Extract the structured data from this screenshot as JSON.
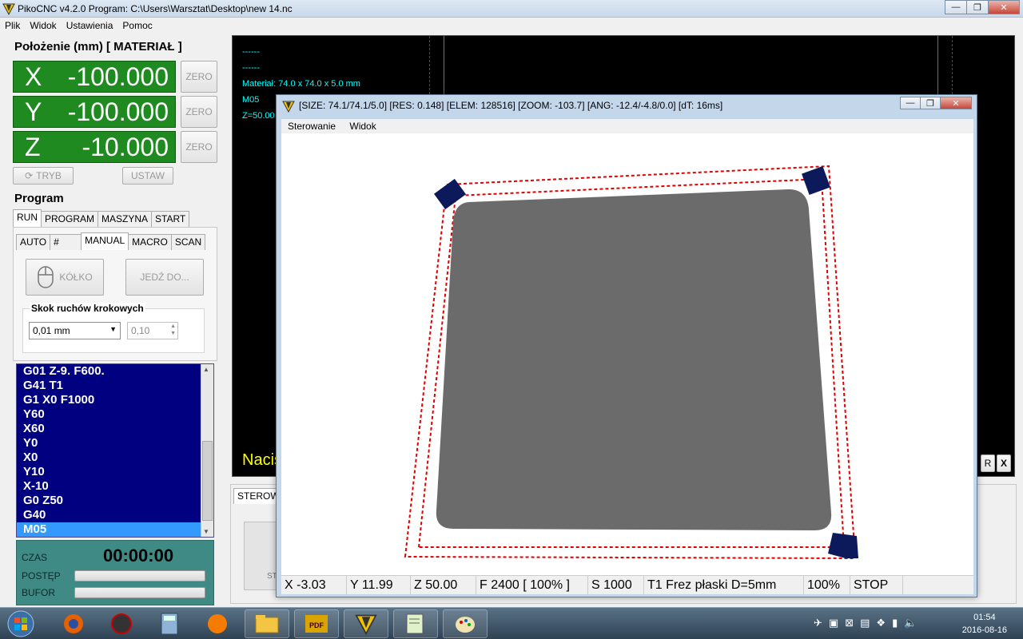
{
  "window": {
    "title": "PikoCNC v4.2.0    Program: C:\\Users\\Warsztat\\Desktop\\new 14.nc",
    "minimize": "—",
    "maximize": "❐",
    "close": "✕"
  },
  "menu": [
    "Plik",
    "Widok",
    "Ustawienia",
    "Pomoc"
  ],
  "position": {
    "title": "Położenie (mm) [ MATERIAŁ ]",
    "axes": [
      {
        "label": "X",
        "value": "-100.000",
        "zero": "ZERO"
      },
      {
        "label": "Y",
        "value": "-100.000",
        "zero": "ZERO"
      },
      {
        "label": "Z",
        "value": "-10.000",
        "zero": "ZERO"
      }
    ],
    "mode_button": "TRYB",
    "set_button": "USTAW"
  },
  "program": {
    "title": "Program",
    "tabs": [
      "RUN",
      "PROGRAM",
      "MASZYNA",
      "START"
    ],
    "subtabs": [
      "AUTO",
      "#",
      "MANUAL",
      "MACRO",
      "SCAN"
    ],
    "wheel_button": "KÓŁKO",
    "goto_button": "JEDŹ DO...",
    "step_group": "Skok ruchów krokowych",
    "step_select": "0,01 mm",
    "step_spin": "0,10",
    "gcode": [
      "G01 Z-9. F600.",
      "G41 T1",
      "G1 X0 F1000",
      "Y60",
      "X60",
      "Y0",
      "X0",
      "Y10",
      "X-10",
      "G0 Z50",
      "G40",
      "M05"
    ],
    "selected_line": 11
  },
  "status": {
    "time_label": "CZAS",
    "time_value": "00:00:00",
    "progress_label": "POSTĘP",
    "buffer_label": "BUFOR",
    "progress": 0,
    "buffer": 0
  },
  "view": {
    "lines": [
      "------",
      "------",
      "Materiał: 74.0 x 74.0 x 5.0 mm",
      "M05",
      "Z=50.00"
    ],
    "yellow_text": "Nacis",
    "side_buttons": [
      "R",
      "X"
    ]
  },
  "bottom": {
    "tab": "STEROW",
    "label": "ST"
  },
  "dialog": {
    "title": "[SIZE: 74.1/74.1/5.0] [RES: 0.148] [ELEM: 128516] [ZOOM: -103.7] [ANG: -12.4/-4.8/0.0] [dT: 16ms]",
    "menu": [
      "Sterowanie",
      "Widok"
    ],
    "status": [
      {
        "key": "x",
        "text": "X -3.03"
      },
      {
        "key": "y",
        "text": "Y 11.99"
      },
      {
        "key": "z",
        "text": "Z 50.00"
      },
      {
        "key": "f",
        "text": "F 2400 [ 100% ]"
      },
      {
        "key": "s",
        "text": "S 1000"
      },
      {
        "key": "t",
        "text": "T1 Frez płaski D=5mm"
      },
      {
        "key": "pct",
        "text": "100%"
      },
      {
        "key": "state",
        "text": "STOP"
      }
    ],
    "colors": {
      "material": "#6b6b6b",
      "toolpath": "#e00000",
      "corner": "#0c1a5c"
    }
  },
  "taskbar": {
    "clock_time": "01:54",
    "clock_date": "2016-08-16"
  }
}
